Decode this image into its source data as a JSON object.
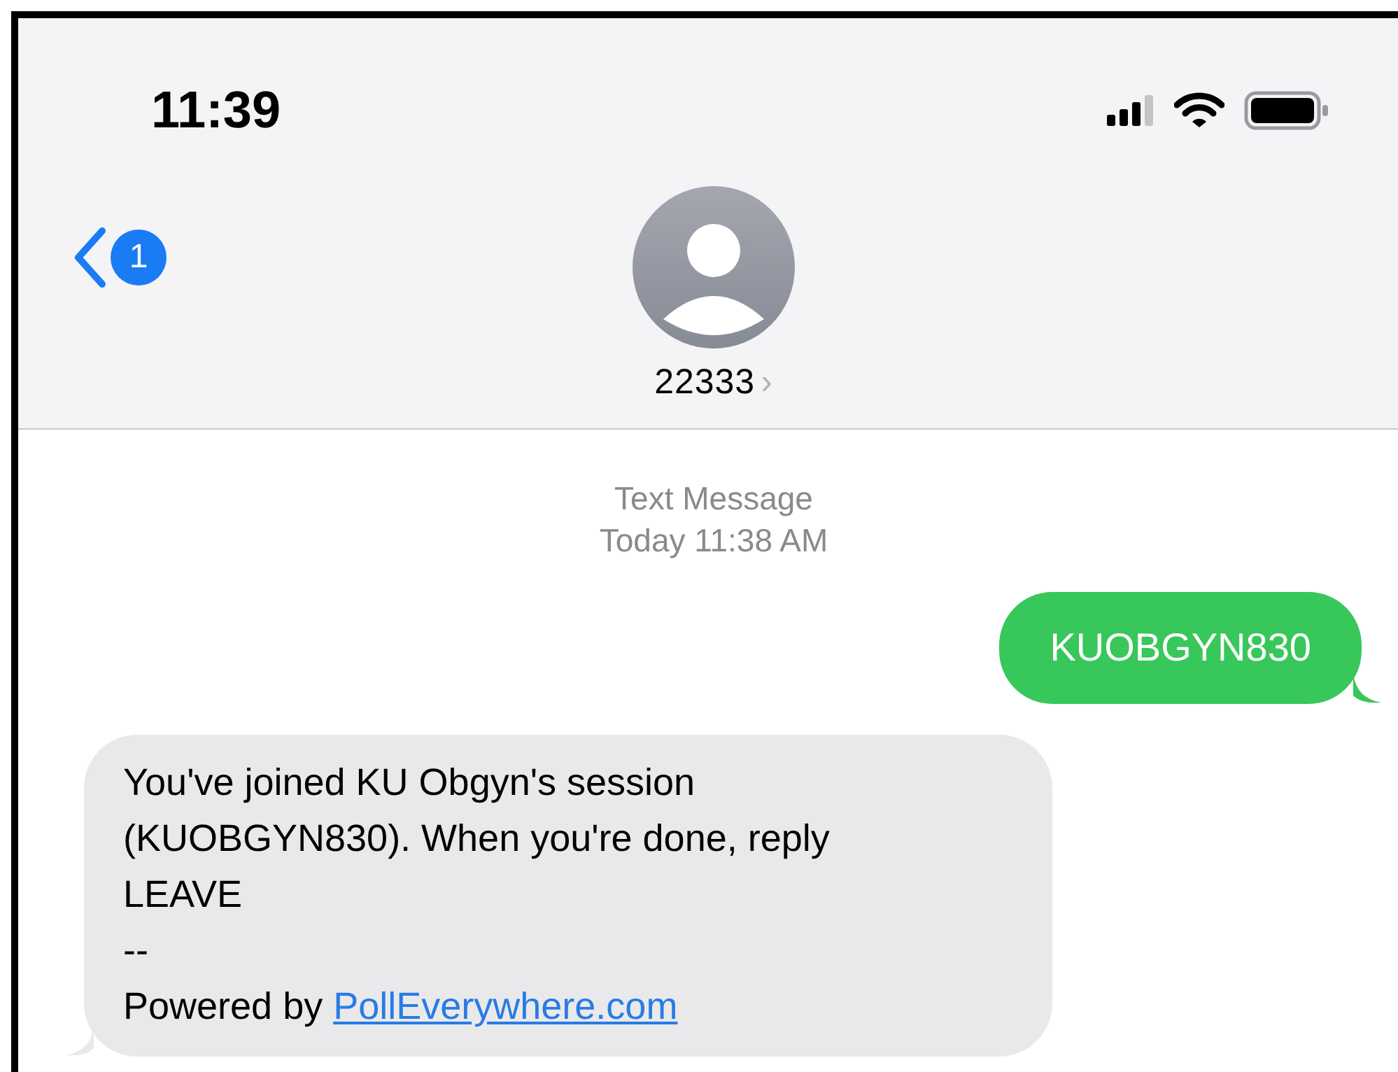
{
  "status_bar": {
    "time": "11:39"
  },
  "header": {
    "back_badge": "1",
    "contact": "22333",
    "chevron": "›"
  },
  "thread_info": {
    "service": "Text Message",
    "timestamp": "Today 11:38 AM"
  },
  "messages": [
    {
      "kind": "sent",
      "text": "KUOBGYN830"
    },
    {
      "kind": "received",
      "text": "You've joined KU Obgyn's session\n(KUOBGYN830). When you're done, reply\nLEAVE\n--\nPowered by ",
      "link": "PollEverywhere.com"
    }
  ]
}
